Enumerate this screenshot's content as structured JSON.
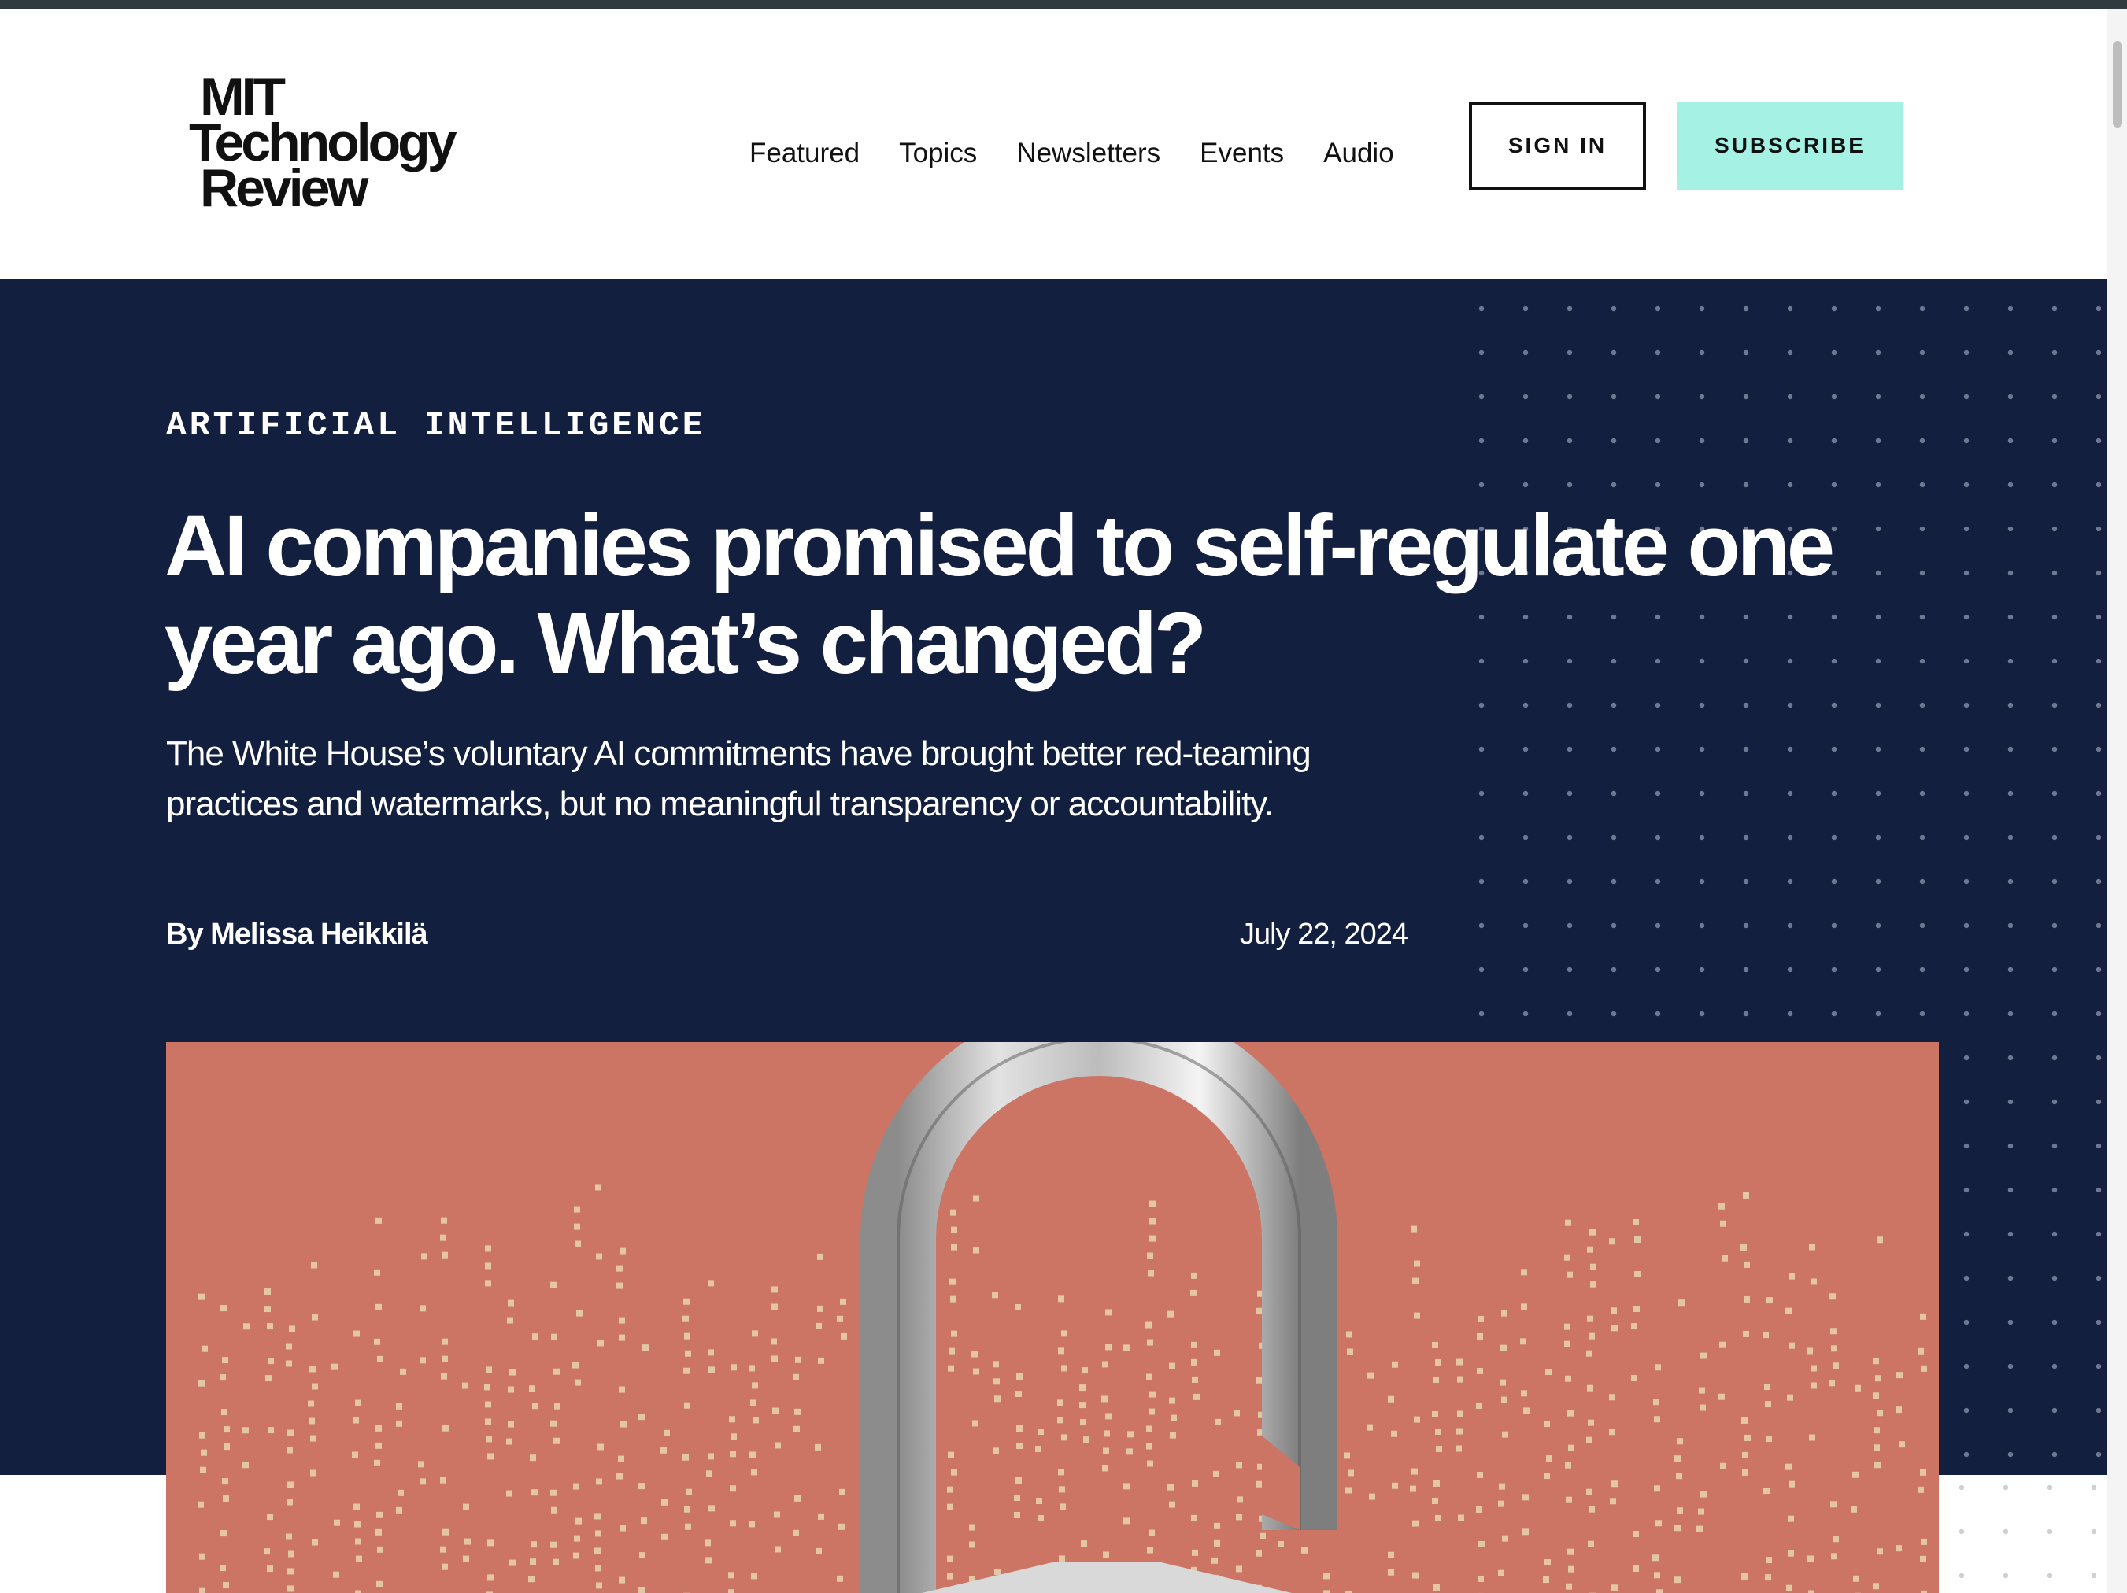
{
  "header": {
    "logo": {
      "line1": "MIT",
      "line2": "Technology",
      "line3": "Review"
    },
    "nav": [
      {
        "label": "Featured"
      },
      {
        "label": "Topics"
      },
      {
        "label": "Newsletters"
      },
      {
        "label": "Events"
      },
      {
        "label": "Audio"
      }
    ],
    "sign_in_label": "SIGN IN",
    "subscribe_label": "SUBSCRIBE"
  },
  "article": {
    "category": "ARTIFICIAL INTELLIGENCE",
    "headline": "AI companies promised to self-regulate one year ago. What’s changed?",
    "dek": "The White House’s voluntary AI commitments have brought better red-teaming practices and watermarks, but no meaningful transparency or accountability.",
    "byline_prefix": "By",
    "author": "Melissa Heikkilä",
    "date": "July 22, 2024",
    "image": {
      "subject": "open-padlock-illustration"
    }
  },
  "colors": {
    "hero_bg": "#131f3e",
    "subscribe_bg": "#a5f1e4",
    "image_bg": "#cc7565"
  }
}
